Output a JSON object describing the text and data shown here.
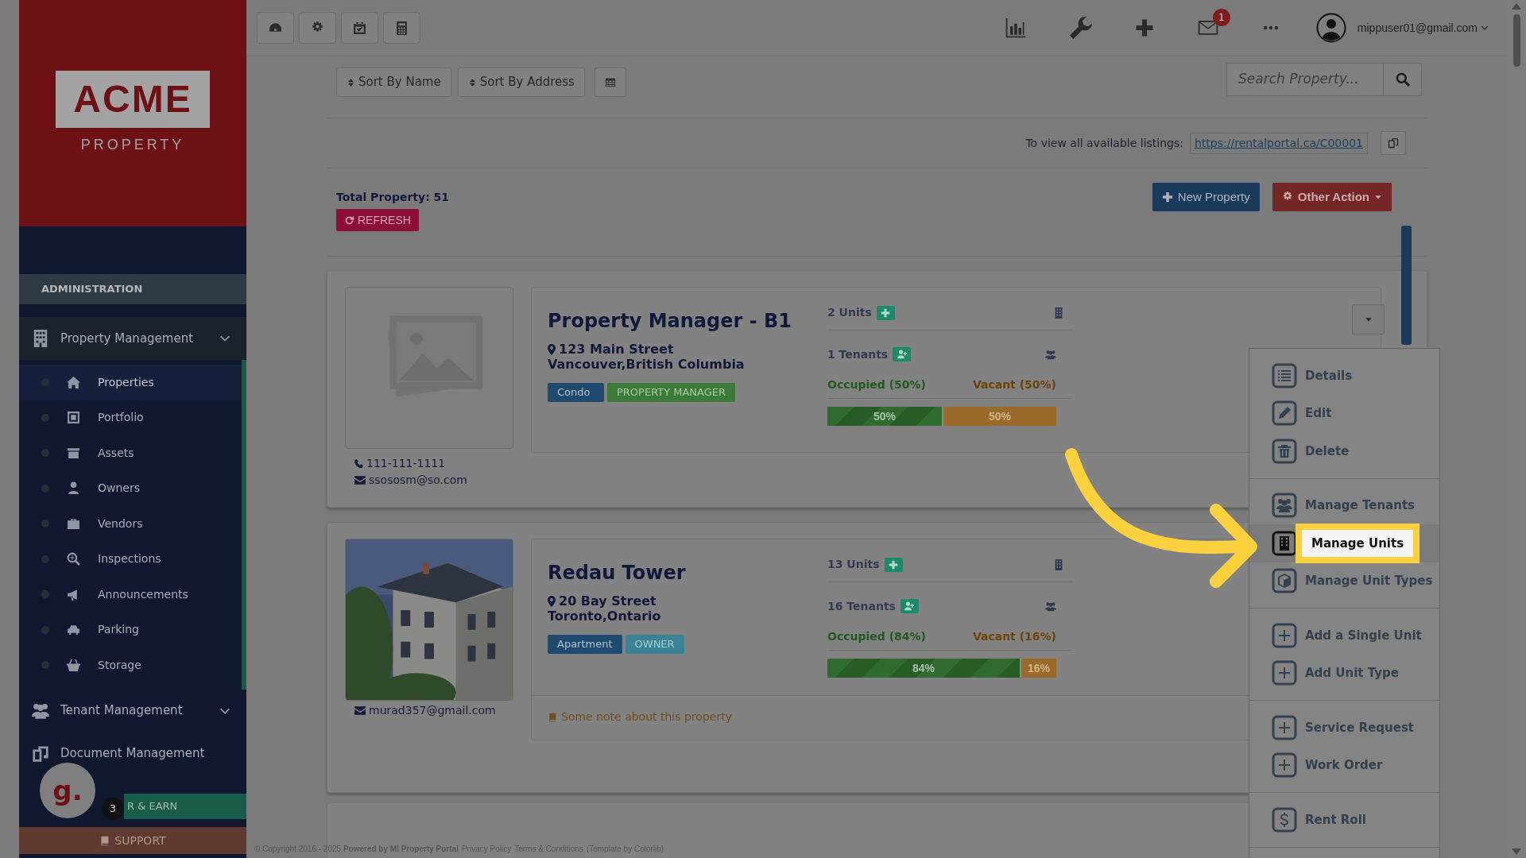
{
  "sidebar": {
    "logo": {
      "name": "ACME",
      "sub": "PROPERTY"
    },
    "section": "ADMINISTRATION",
    "groups": [
      {
        "label": "Property Management",
        "expanded": true,
        "children": [
          {
            "label": "Properties",
            "selected": true
          },
          {
            "label": "Portfolio",
            "selected": false
          },
          {
            "label": "Assets",
            "selected": false
          },
          {
            "label": "Owners",
            "selected": false
          },
          {
            "label": "Vendors",
            "selected": false
          },
          {
            "label": "Inspections",
            "selected": false
          },
          {
            "label": "Announcements",
            "selected": false
          },
          {
            "label": "Parking",
            "selected": false
          },
          {
            "label": "Storage",
            "selected": false
          }
        ]
      },
      {
        "label": "Tenant Management",
        "expanded": false
      },
      {
        "label": "Document Management"
      }
    ],
    "refer": "R & EARN",
    "support": "SUPPORT",
    "chat": {
      "letter": "g.",
      "badge": "3"
    }
  },
  "topbar": {
    "mail_badge": "1",
    "user": "mippuser01@gmail.com"
  },
  "toolbar": {
    "sort_buttons": [
      "Sort By Name",
      "Sort By Address"
    ],
    "search": {
      "placeholder": "Search Property..."
    }
  },
  "listings": {
    "label": "To view all available listings:",
    "url": "https://rentalportal.ca/C00001"
  },
  "total": "Total Property: 51",
  "refresh": "REFRESH",
  "new_property": "New Property",
  "other_action": "Other Action",
  "properties": [
    {
      "image": {
        "kind": "placeholder"
      },
      "name": "Property Manager - B1",
      "address": [
        "123 Main Street",
        "Vancouver,British Columbia"
      ],
      "tags": [
        {
          "text": "Condo",
          "kind": "type"
        },
        {
          "text": "PROPERTY MANAGER",
          "kind": "role"
        }
      ],
      "phone": "111-111-1111",
      "email": "ssososm@so.com",
      "units": "2 Units",
      "tenants": "1 Tenants",
      "occupied": "Occupied (50%)",
      "vacant": "Vacant (50%)",
      "bar": {
        "level": 0.5,
        "filled_label": "50%",
        "empty_label": "50%"
      }
    },
    {
      "image": {
        "kind": "picture"
      },
      "name": "Redau Tower",
      "address": [
        "20 Bay Street",
        "Toronto,Ontario"
      ],
      "tags": [
        {
          "text": "Apartment",
          "kind": "type"
        },
        {
          "text": "OWNER",
          "kind": "owner"
        }
      ],
      "email": "murad357@gmail.com",
      "units": "13 Units",
      "tenants": "16 Tenants",
      "occupied": "Occupied (84%)",
      "vacant": "Vacant (16%)",
      "bar": {
        "level": 0.84,
        "filled_label": "84%",
        "empty_label": "16%"
      },
      "note": "Some note about this property"
    }
  ],
  "menu": {
    "groups": [
      [
        {
          "label": "Details",
          "selected": false
        },
        {
          "label": "Edit",
          "selected": false
        },
        {
          "label": "Delete",
          "selected": false
        }
      ],
      [
        {
          "label": "Manage Tenants",
          "selected": false
        },
        {
          "label": "Manage Units",
          "selected": true
        },
        {
          "label": "Manage Unit Types",
          "selected": false
        }
      ],
      [
        {
          "label": "Add a Single Unit",
          "selected": false
        },
        {
          "label": "Add Unit Type",
          "selected": false
        }
      ],
      [
        {
          "label": "Service Request",
          "selected": false
        },
        {
          "label": "Work Order",
          "selected": false
        }
      ],
      [
        {
          "label": "Rent Roll",
          "selected": false
        }
      ]
    ]
  },
  "footer": {
    "text": "© Copyright 2016 - 2025 **Powered by MI Property Portal**",
    "links": [
      "Privacy Policy",
      "Terms & Conditions"
    ],
    "credit": "(Template by Colorlib)"
  }
}
